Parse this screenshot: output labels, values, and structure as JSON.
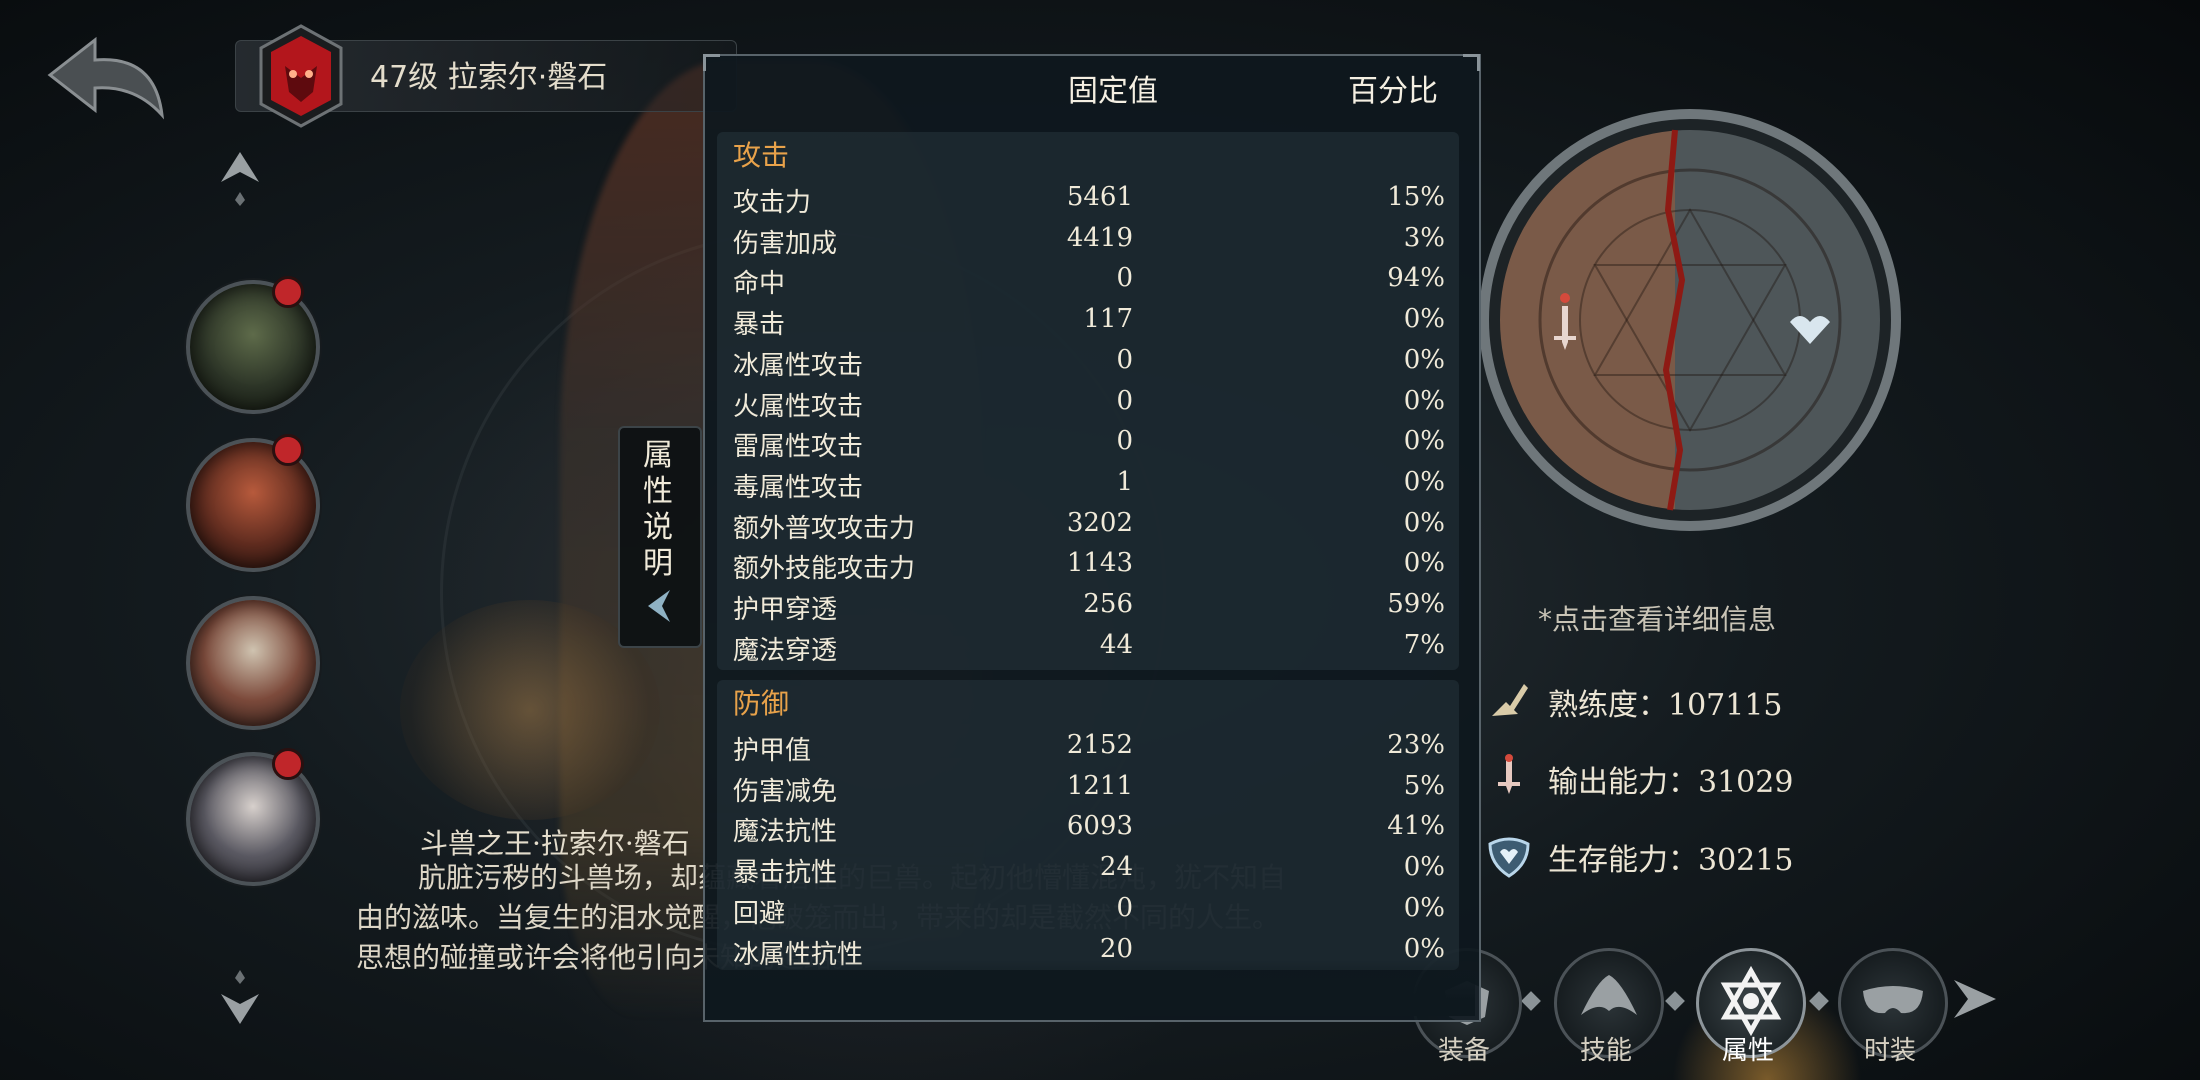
{
  "header": {
    "hero_title": "47级 拉索尔·磐石"
  },
  "side_tab": {
    "label": "属性说明"
  },
  "stats_panel": {
    "col_fixed": "固定值",
    "col_percent": "百分比",
    "sections": [
      {
        "title": "攻击",
        "rows": [
          {
            "name": "攻击力",
            "fixed": "5461",
            "percent": "15%"
          },
          {
            "name": "伤害加成",
            "fixed": "4419",
            "percent": "3%"
          },
          {
            "name": "命中",
            "fixed": "0",
            "percent": "94%"
          },
          {
            "name": "暴击",
            "fixed": "117",
            "percent": "0%"
          },
          {
            "name": "冰属性攻击",
            "fixed": "0",
            "percent": "0%"
          },
          {
            "name": "火属性攻击",
            "fixed": "0",
            "percent": "0%"
          },
          {
            "name": "雷属性攻击",
            "fixed": "0",
            "percent": "0%"
          },
          {
            "name": "毒属性攻击",
            "fixed": "1",
            "percent": "0%"
          },
          {
            "name": "额外普攻攻击力",
            "fixed": "3202",
            "percent": "0%"
          },
          {
            "name": "额外技能攻击力",
            "fixed": "1143",
            "percent": "0%"
          },
          {
            "name": "护甲穿透",
            "fixed": "256",
            "percent": "59%"
          },
          {
            "name": "魔法穿透",
            "fixed": "44",
            "percent": "7%"
          }
        ]
      },
      {
        "title": "防御",
        "rows": [
          {
            "name": "护甲值",
            "fixed": "2152",
            "percent": "23%"
          },
          {
            "name": "伤害减免",
            "fixed": "1211",
            "percent": "5%"
          },
          {
            "name": "魔法抗性",
            "fixed": "6093",
            "percent": "41%"
          },
          {
            "name": "暴击抗性",
            "fixed": "24",
            "percent": "0%"
          },
          {
            "name": "回避",
            "fixed": "0",
            "percent": "0%"
          },
          {
            "name": "冰属性抗性",
            "fixed": "20",
            "percent": "0%"
          }
        ]
      }
    ]
  },
  "lore": {
    "title": "斗兽之王·拉索尔·磐石",
    "body": "肮脏污秽的斗兽场，却蕴藏着潜在的巨兽。起初他懵懂混沌，犹不知自由的滋味。当复生的泪水觉醒，他破笼而出，带来的却是截然不同的人生。思想的碰撞或许会将他引向未知的道路。"
  },
  "right_panel": {
    "hint": "*点击查看详细信息",
    "proficiency_label": "熟练度：",
    "proficiency_value": "107115",
    "output_label": "输出能力：",
    "output_value": "31029",
    "survival_label": "生存能力：",
    "survival_value": "30215"
  },
  "bottom_tabs": [
    {
      "label": "装备",
      "icon": "equipment-icon"
    },
    {
      "label": "技能",
      "icon": "skill-icon"
    },
    {
      "label": "属性",
      "icon": "attribute-icon",
      "active": true
    },
    {
      "label": "时装",
      "icon": "costume-icon"
    }
  ],
  "colors": {
    "accent_orange": "#e8a24a",
    "notify_red": "#c0262a"
  }
}
